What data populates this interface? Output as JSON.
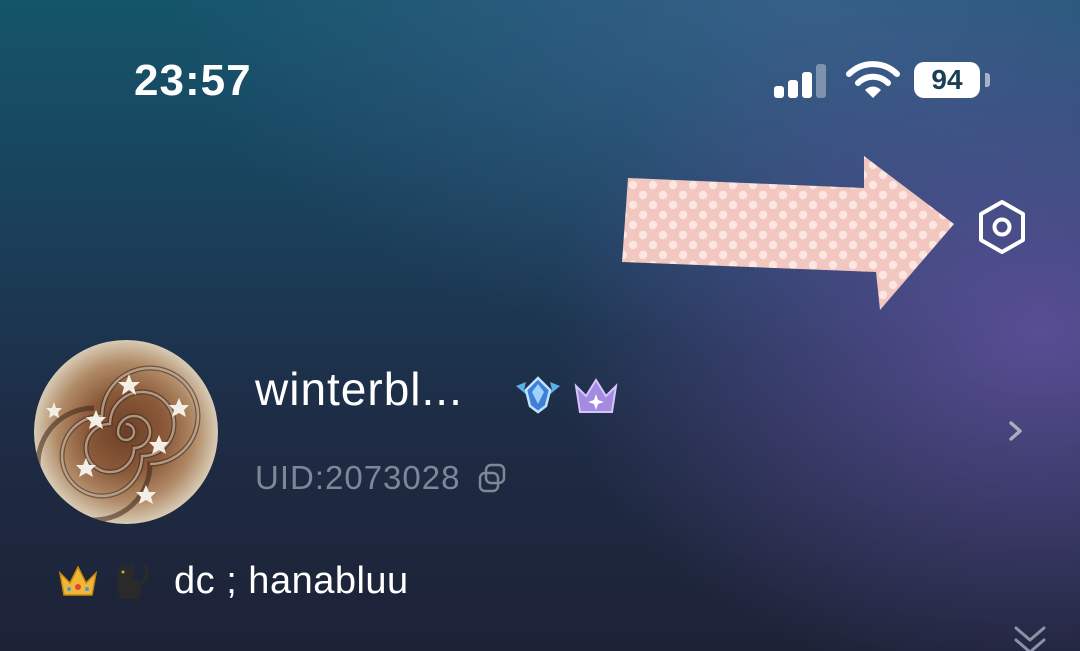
{
  "status_bar": {
    "time": "23:57",
    "battery": "94",
    "icons": [
      "signal-icon",
      "wifi-icon",
      "battery-icon"
    ]
  },
  "header": {
    "settings_icon": "hexagon-gear-icon",
    "overlay_arrow": "polka-dot-arrow-sticker"
  },
  "profile": {
    "username": "winterbl...",
    "uid": "UID:2073028",
    "badges": [
      "diamond-wings-badge",
      "purple-crown-badge"
    ],
    "avatar": "cinnamon-roll-avatar"
  },
  "bio": {
    "emojis": [
      "crown",
      "black-cat"
    ],
    "text": "dc ; hanabluu"
  },
  "colors": {
    "accent_text": "#ffffff",
    "muted_text": "#7d8796",
    "arrow_fill": "#f2c7c0",
    "background_top": "#14556a",
    "background_bottom": "#1d2236"
  }
}
